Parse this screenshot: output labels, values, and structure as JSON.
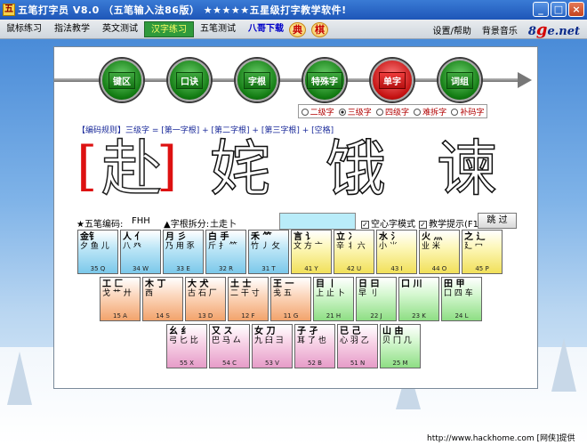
{
  "window": {
    "title": "五笔打字员 V8.0 （五笔输入法86版） ★★★★★五星级打字教学软件!",
    "icon_char": "五",
    "buttons": {
      "minimize": "_",
      "maximize": "□",
      "close": "×"
    }
  },
  "menu": {
    "items": [
      "鼠标练习",
      "指法教学",
      "英文测试",
      "汉字练习",
      "五笔测试",
      "八哥下载"
    ],
    "seals": [
      "典",
      "棋"
    ],
    "right": [
      "设置/帮助",
      "背景音乐"
    ],
    "logo_num": "8",
    "logo_g": "g",
    "logo_text": "e.net"
  },
  "nav": {
    "buttons": [
      "键区",
      "口诀",
      "字根",
      "特殊字",
      "单字",
      "词组"
    ],
    "active": "单字"
  },
  "levels": [
    "二级字",
    "三级字",
    "四级字",
    "难拆字",
    "补码字"
  ],
  "rule_text": "【编码规则】三级字 = [第一字根] + [第二字根] + [第三字根] + [空格]",
  "practice": {
    "current": "赴",
    "upcoming": [
      "姹",
      "饿",
      "谏"
    ],
    "left_bracket": "[",
    "right_bracket": "]"
  },
  "info": {
    "code_label": "★五笔编码:",
    "code_value": "FHH",
    "split_label": "▲字根拆分:",
    "split_value": "土走卜",
    "option1": "空心字模式",
    "option2": "教学提示(F1)",
    "skip": "跳 过"
  },
  "keyboard": {
    "row1": [
      {
        "main": "金钅",
        "roots": "夕 鱼 儿",
        "code": "35 Q",
        "color": "blue"
      },
      {
        "main": "人 亻",
        "roots": "八 癶",
        "code": "34 W",
        "color": "blue"
      },
      {
        "main": "月 彡",
        "roots": "乃 用 豕",
        "code": "33 E",
        "color": "blue"
      },
      {
        "main": "白 手",
        "roots": "斤 扌 ⺮",
        "code": "32 R",
        "color": "blue"
      },
      {
        "main": "禾 ⺮",
        "roots": "竹 丿 攵",
        "code": "31 T",
        "color": "blue"
      },
      {
        "main": "言 讠",
        "roots": "文 方 亠",
        "code": "41 Y",
        "color": "yellow"
      },
      {
        "main": "立 冫",
        "roots": "辛 丬 六",
        "code": "42 U",
        "color": "yellow"
      },
      {
        "main": "水 氵",
        "roots": "小 ⺌",
        "code": "43 I",
        "color": "yellow"
      },
      {
        "main": "火 灬",
        "roots": "业 米",
        "code": "44 O",
        "color": "yellow"
      },
      {
        "main": "之 辶",
        "roots": "廴 冖",
        "code": "45 P",
        "color": "yellow"
      }
    ],
    "row2": [
      {
        "main": "工 匚",
        "roots": "戈 艹 廾",
        "code": "15 A",
        "color": "orange"
      },
      {
        "main": "木 丁",
        "roots": "西",
        "code": "14 S",
        "color": "orange"
      },
      {
        "main": "大 犬",
        "roots": "古 石 厂",
        "code": "13 D",
        "color": "orange"
      },
      {
        "main": "土 士",
        "roots": "二 干 寸",
        "code": "12 F",
        "color": "orange"
      },
      {
        "main": "王 一",
        "roots": "戋 五",
        "code": "11 G",
        "color": "orange"
      },
      {
        "main": "目 丨",
        "roots": "上 止 卜",
        "code": "21 H",
        "color": "green"
      },
      {
        "main": "日 曰",
        "roots": "早 刂",
        "code": "22 J",
        "color": "green"
      },
      {
        "main": "口 川",
        "roots": "",
        "code": "23 K",
        "color": "green"
      },
      {
        "main": "田 甲",
        "roots": "囗 四 车",
        "code": "24 L",
        "color": "green"
      }
    ],
    "row3": [
      {
        "main": "幺 纟",
        "roots": "弓 匕 比",
        "code": "55 X",
        "color": "pink"
      },
      {
        "main": "又 ス",
        "roots": "巴 马 厶",
        "code": "54 C",
        "color": "pink"
      },
      {
        "main": "女 刀",
        "roots": "九 臼 ⺕",
        "code": "53 V",
        "color": "pink"
      },
      {
        "main": "子 孑",
        "roots": "耳 了 也",
        "code": "52 B",
        "color": "pink"
      },
      {
        "main": "已 己",
        "roots": "心 羽 乙",
        "code": "51 N",
        "color": "pink"
      },
      {
        "main": "山 由",
        "roots": "贝 冂 几",
        "code": "25 M",
        "color": "green"
      }
    ]
  },
  "status_text": "http://www.hackhome.com [网侠]提供"
}
